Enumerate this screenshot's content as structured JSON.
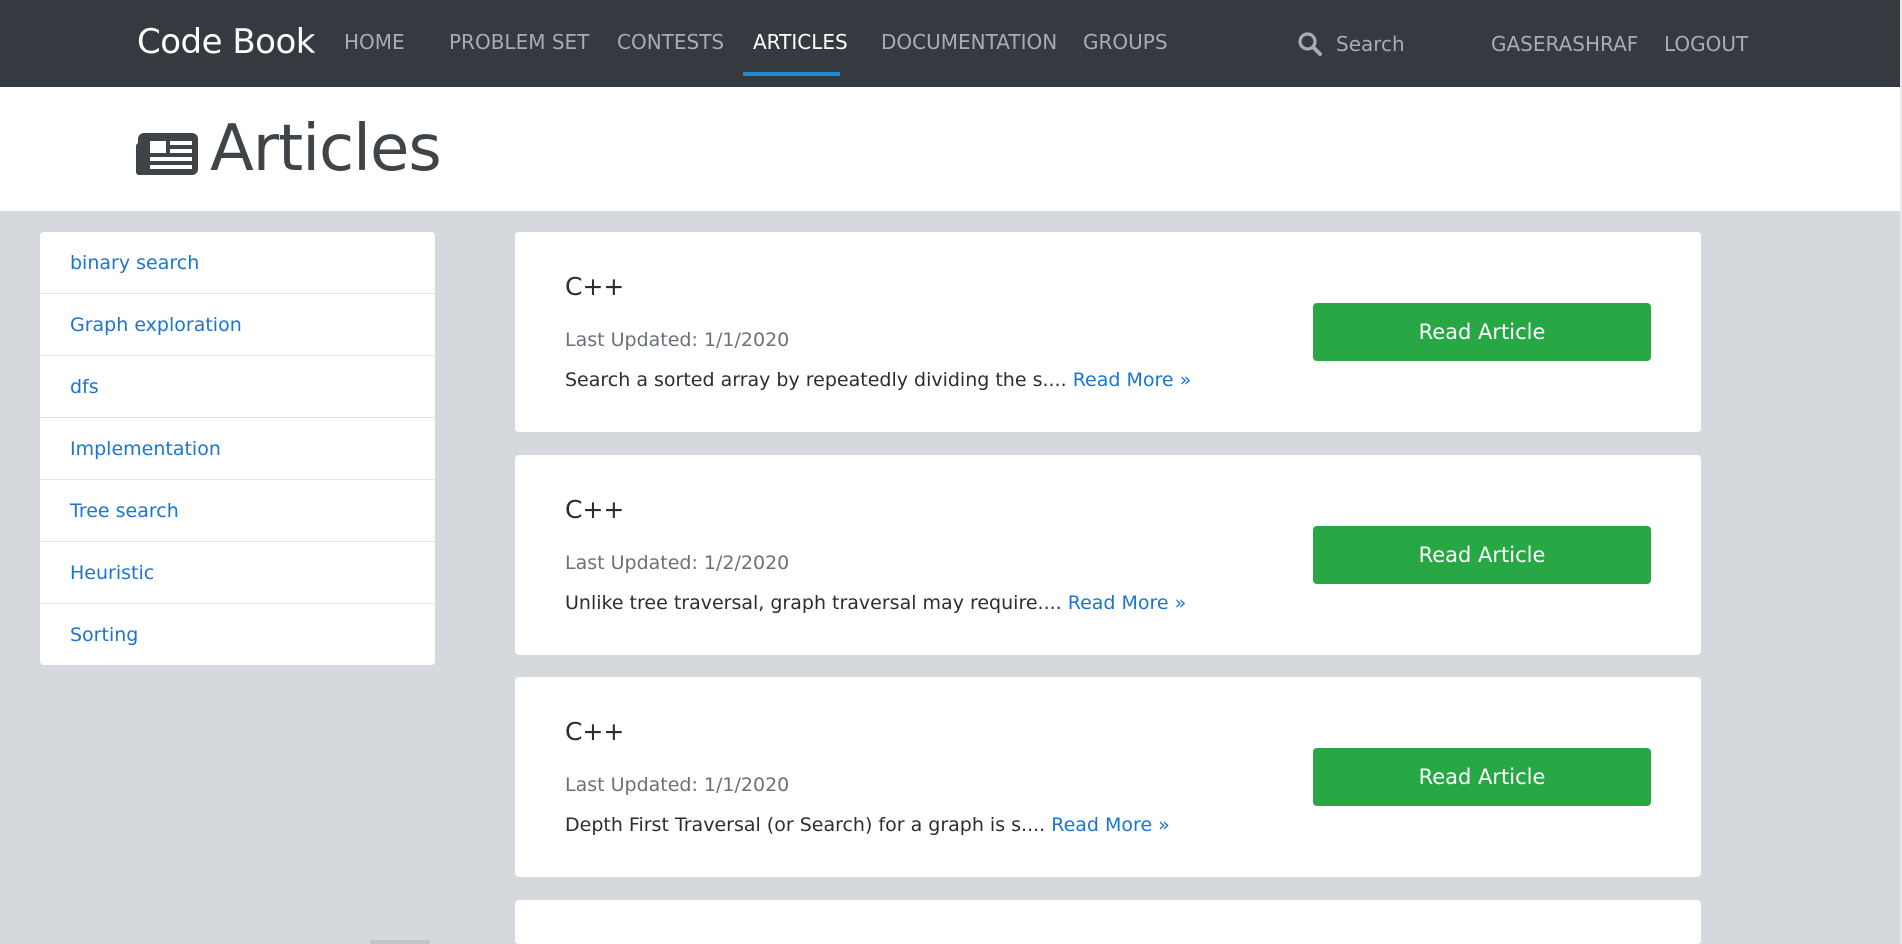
{
  "navbar": {
    "brand": "Code Book",
    "links": [
      {
        "label": "HOME",
        "active": false
      },
      {
        "label": "PROBLEM SET",
        "active": false
      },
      {
        "label": "CONTESTS",
        "active": false
      },
      {
        "label": "ARTICLES",
        "active": true
      },
      {
        "label": "DOCUMENTATION",
        "active": false
      },
      {
        "label": "GROUPS",
        "active": false
      }
    ],
    "search_placeholder": "Search",
    "username": "GASERASHRAF",
    "logout": "LOGOUT"
  },
  "header": {
    "title": "Articles",
    "icon": "newspaper-icon"
  },
  "sidebar": {
    "items": [
      {
        "label": "binary search"
      },
      {
        "label": "Graph exploration"
      },
      {
        "label": "dfs"
      },
      {
        "label": "Implementation"
      },
      {
        "label": "Tree search"
      },
      {
        "label": "Heuristic"
      },
      {
        "label": "Sorting"
      }
    ]
  },
  "articles": [
    {
      "title": "C++",
      "updated": "Last Updated: 1/1/2020",
      "excerpt": "Search a sorted array by repeatedly dividing the s.... ",
      "read_more": "Read More »",
      "button": "Read Article"
    },
    {
      "title": "C++",
      "updated": "Last Updated: 1/2/2020",
      "excerpt": "Unlike tree traversal, graph traversal may require.... ",
      "read_more": "Read More »",
      "button": "Read Article"
    },
    {
      "title": "C++",
      "updated": "Last Updated: 1/1/2020",
      "excerpt": "Depth First Traversal (or Search) for a graph is s.... ",
      "read_more": "Read More »",
      "button": "Read Article"
    }
  ],
  "colors": {
    "navbar_bg": "#353a41",
    "accent_blue": "#1f8ad6",
    "button_green": "#28a745",
    "link_blue": "#1a75d2",
    "page_bg": "#d5d9dd"
  }
}
